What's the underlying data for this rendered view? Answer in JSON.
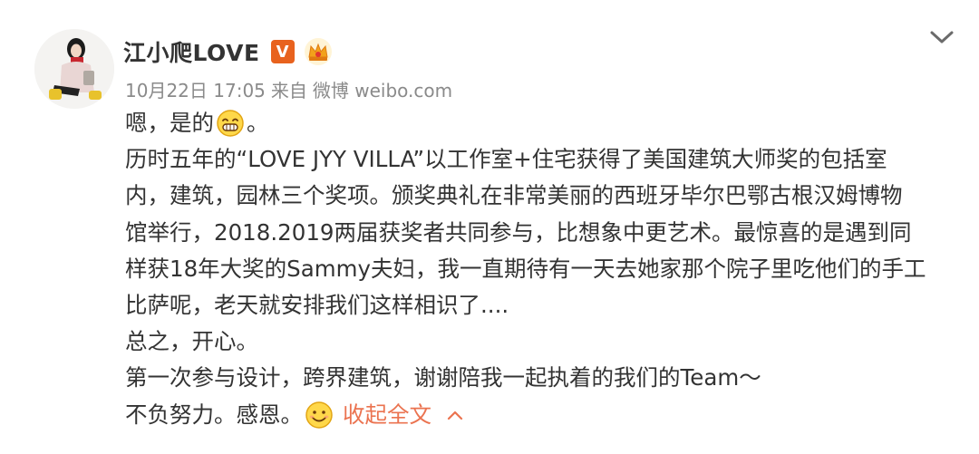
{
  "post": {
    "author": {
      "name": "江小爬LOVE",
      "verified_mark": "V",
      "badge_icon": "crown-icon",
      "avatar_icon": "avatar-photo"
    },
    "meta": {
      "date": "10月22日 17:05",
      "source_prefix": "来自",
      "source": "微博 weibo.com"
    },
    "menu_icon": "chevron-down-icon",
    "body": {
      "line1_text": "嗯，是的",
      "line1_end": "。",
      "line2": "历时五年的“LOVE JYY VILLA”以工作室+住宅获得了美国建筑大师奖的包括室",
      "line3": "内，建筑，园林三个奖项。颁奖典礼在非常美丽的西班牙毕尔巴鄂古根汉姆博物",
      "line4": "馆举行，2018.2019两届获奖者共同参与，比想象中更艺术。最惊喜的是遇到同",
      "line5": "样获18年大奖的Sammy夫妇，我一直期待有一天去她家那个院子里吃他们的手工",
      "line6": "比萨呢，老天就安排我们这样相识了....",
      "line7": "总之，开心。",
      "line8": "第一次参与设计，跨界建筑，谢谢陪我一起执着的我们的Team～",
      "line9_text": "不负努力。感恩。",
      "collapse_label": "收起全文"
    },
    "colors": {
      "text": "#333333",
      "meta": "#8a8a8a",
      "link": "#eb7350",
      "vip_badge": "#e8621e"
    }
  }
}
